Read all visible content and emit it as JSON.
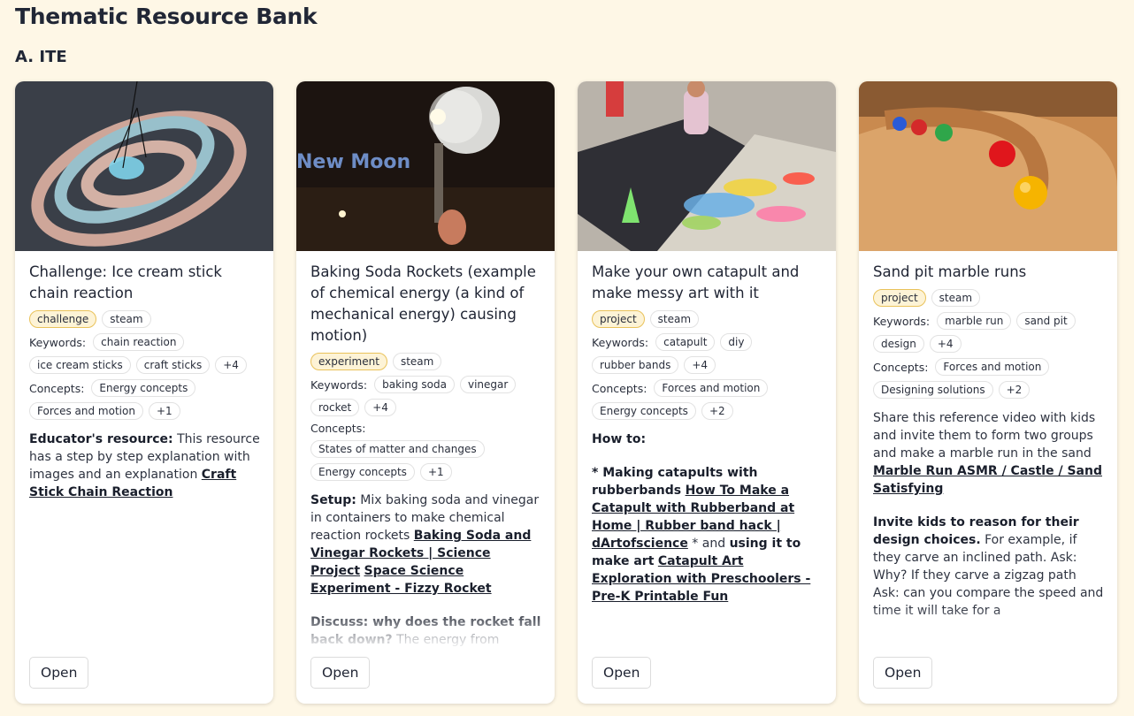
{
  "page": {
    "title": "Thematic Resource Bank",
    "section": "A. ITE"
  },
  "open_label": "Open",
  "keywords_label": "Keywords:",
  "concepts_label": "Concepts:",
  "cards": [
    {
      "title": "Challenge: Ice cream stick chain reaction",
      "type": "challenge",
      "steam": "steam",
      "keywords": [
        "chain reaction",
        "ice cream sticks",
        "craft sticks"
      ],
      "kw_more": "+4",
      "concepts": [
        "Energy concepts",
        "Forces and motion"
      ],
      "con_more": "+1",
      "desc": {
        "p1_bold": "Educator's resource:",
        "p1_text": " This resource has a step by step explanation with images and an explanation ",
        "p1_link": "Craft Stick Chain Reaction"
      }
    },
    {
      "title": "Baking Soda Rockets (example of chemical energy (a kind of mechanical energy) causing motion)",
      "image_caption": "New Moon",
      "type": "experiment",
      "steam": "steam",
      "keywords": [
        "baking soda",
        "vinegar",
        "rocket"
      ],
      "kw_more": "+4",
      "concepts": [
        "States of matter and changes",
        "Energy concepts"
      ],
      "con_more": "+1",
      "desc": {
        "p1_bold": "Setup:",
        "p1_text": " Mix baking soda and vinegar in containers to make chemical reaction rockets ",
        "p1_link": "Baking Soda and Vinegar Rockets | Science Project",
        "p1_link2": "Space Science Experiment - Fizzy Rocket",
        "p2_bold": "Discuss: why does the rocket fall back down?",
        "p2_text": " The energy from chemical reaction pushes the container up, meanwhile the gravitational energy is"
      }
    },
    {
      "title": "Make your own catapult and make messy art with it",
      "type": "project",
      "steam": "steam",
      "keywords": [
        "catapult",
        "diy",
        "rubber bands"
      ],
      "kw_more": "+4",
      "concepts": [
        "Forces and motion",
        "Energy concepts"
      ],
      "con_more": "+2",
      "desc": {
        "p1_bold": "How to:",
        "p2_star": "* ",
        "p2_bold": "Making catapults with rubberbands",
        "p2_link": "How To Make a Catapult with Rubberband at Home | Rubber band hack | dArtofscience",
        "p2_text": " * and ",
        "p2_bold2": "using it to make art",
        "p2_link2": "Catapult Art Exploration with Preschoolers - Pre-K Printable Fun"
      }
    },
    {
      "title": "Sand pit marble runs",
      "type": "project",
      "steam": "steam",
      "keywords": [
        "marble run",
        "sand pit",
        "design"
      ],
      "kw_more": "+4",
      "concepts": [
        "Forces and motion",
        "Designing solutions"
      ],
      "con_more": "+2",
      "desc": {
        "p1_text": "Share this reference video with kids and invite them to form two groups and make a marble run in the sand ",
        "p1_link": "Marble Run ASMR / Castle / Sand Satisfying",
        "p2_bold": "Invite kids to reason for their design choices.",
        "p2_text": " For example, if they carve an inclined path. Ask: Why? If they carve a zigzag path Ask: can you compare the speed and time it will take for a"
      }
    }
  ],
  "colors": {
    "background": "#fef7e6",
    "type_tag_bg": "#fdf3d6",
    "type_tag_border": "#e9c25a"
  }
}
